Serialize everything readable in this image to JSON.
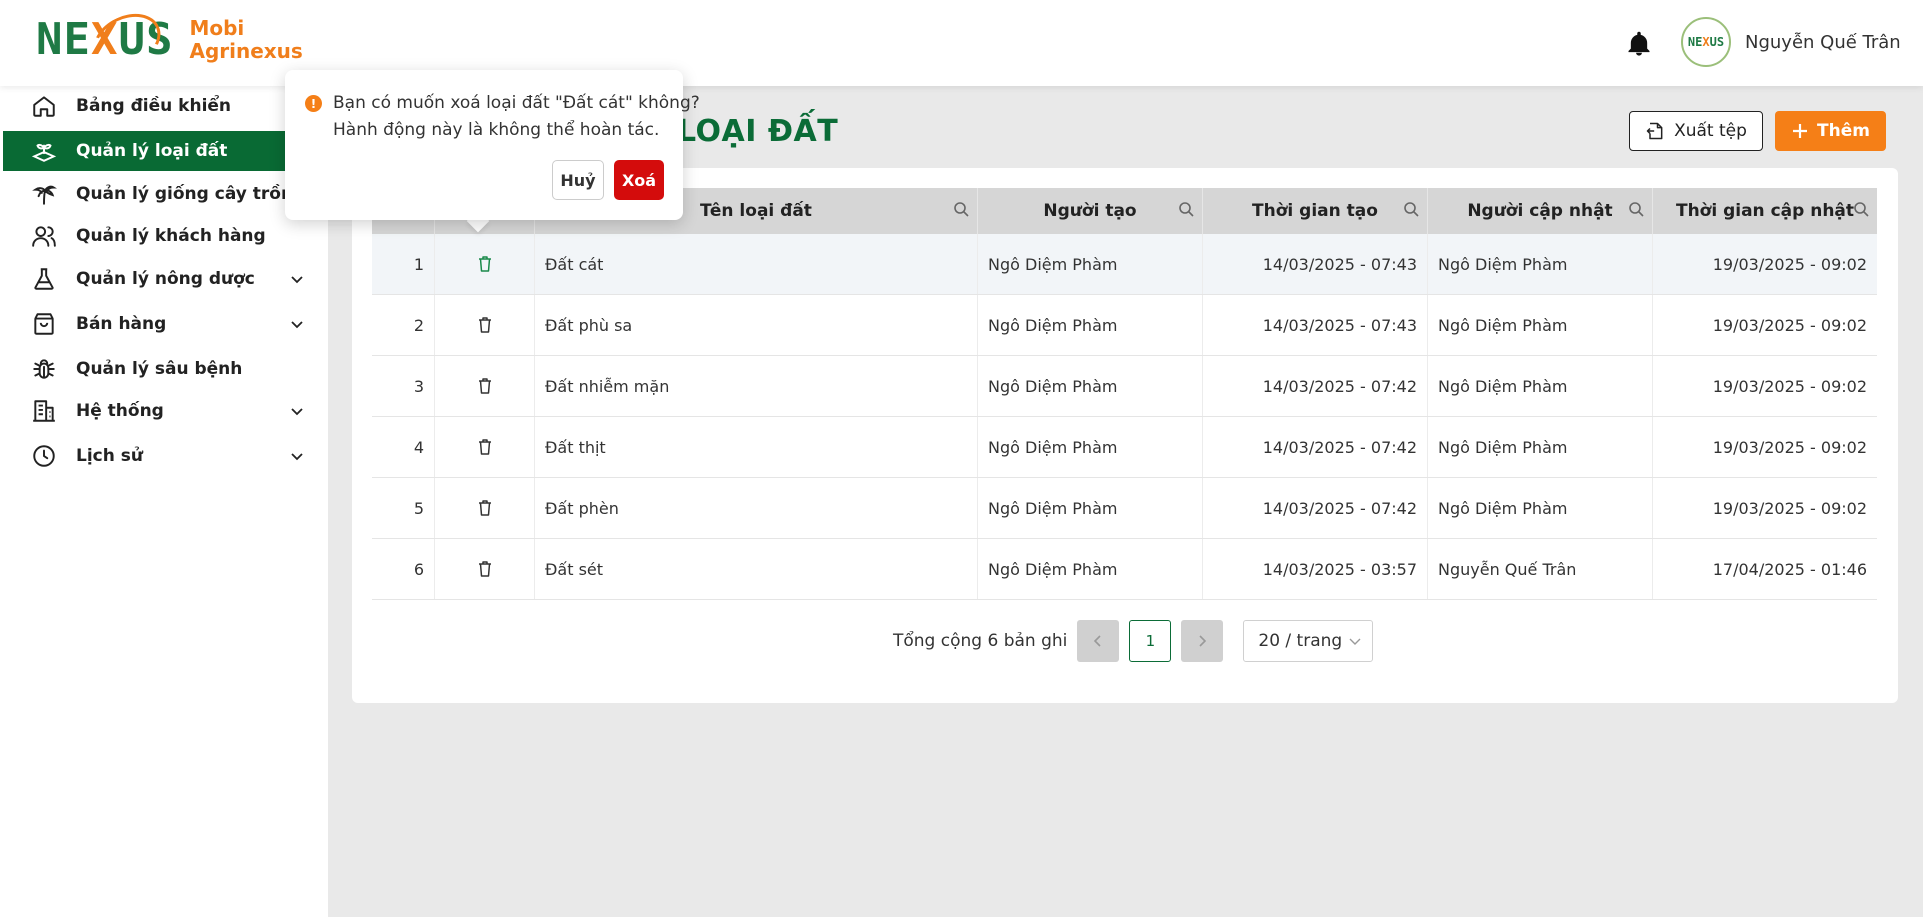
{
  "brand": {
    "line1": "Mobi",
    "line2": "Agrinexus",
    "logo_text": "NEXUS"
  },
  "header": {
    "user_name": "Nguyễn Quế Trân",
    "avatar_text": "NEXUS"
  },
  "sidebar": {
    "items": [
      {
        "label": "Bảng điều khiển",
        "icon": "home-icon",
        "active": false,
        "expandable": false
      },
      {
        "label": "Quản lý loại đất",
        "icon": "soil-sprout-icon",
        "active": true,
        "expandable": false
      },
      {
        "label": "Quản lý giống cây trồng",
        "icon": "palm-tree-icon",
        "active": false,
        "expandable": false
      },
      {
        "label": "Quản lý khách hàng",
        "icon": "users-icon",
        "active": false,
        "expandable": false
      },
      {
        "label": "Quản lý nông dược",
        "icon": "flask-icon",
        "active": false,
        "expandable": true
      },
      {
        "label": "Bán hàng",
        "icon": "shopping-bag-icon",
        "active": false,
        "expandable": true
      },
      {
        "label": "Quản lý sâu bệnh",
        "icon": "bug-icon",
        "active": false,
        "expandable": false
      },
      {
        "label": "Hệ thống",
        "icon": "building-icon",
        "active": false,
        "expandable": true
      },
      {
        "label": "Lịch sử",
        "icon": "clock-icon",
        "active": false,
        "expandable": true
      }
    ]
  },
  "main": {
    "title_visible": "LOẠI ĐẤT",
    "export_label": "Xuất tệp",
    "add_label": "Thêm"
  },
  "table": {
    "columns": [
      "Tên loại đất",
      "Người tạo",
      "Thời gian tạo",
      "Người cập nhật",
      "Thời gian cập nhật"
    ],
    "rows": [
      {
        "no": "1",
        "name": "Đất cát",
        "creator": "Ngô Diệm Phàm",
        "created": "14/03/2025 - 07:43",
        "updater": "Ngô Diệm Phàm",
        "updated": "19/03/2025 - 09:02"
      },
      {
        "no": "2",
        "name": "Đất phù sa",
        "creator": "Ngô Diệm Phàm",
        "created": "14/03/2025 - 07:43",
        "updater": "Ngô Diệm Phàm",
        "updated": "19/03/2025 - 09:02"
      },
      {
        "no": "3",
        "name": "Đất nhiễm mặn",
        "creator": "Ngô Diệm Phàm",
        "created": "14/03/2025 - 07:42",
        "updater": "Ngô Diệm Phàm",
        "updated": "19/03/2025 - 09:02"
      },
      {
        "no": "4",
        "name": "Đất thịt",
        "creator": "Ngô Diệm Phàm",
        "created": "14/03/2025 - 07:42",
        "updater": "Ngô Diệm Phàm",
        "updated": "19/03/2025 - 09:02"
      },
      {
        "no": "5",
        "name": "Đất phèn",
        "creator": "Ngô Diệm Phàm",
        "created": "14/03/2025 - 07:42",
        "updater": "Ngô Diệm Phàm",
        "updated": "19/03/2025 - 09:02"
      },
      {
        "no": "6",
        "name": "Đất sét",
        "creator": "Ngô Diệm Phàm",
        "created": "14/03/2025 - 03:57",
        "updater": "Nguyễn Quế Trân",
        "updated": "17/04/2025 - 01:46"
      }
    ]
  },
  "pagination": {
    "total_label": "Tổng cộng 6 bản ghi",
    "current_page": "1",
    "page_size": "20 / trang"
  },
  "popconfirm": {
    "line1": "Bạn có muốn xoá loại đất \"Đất cát\" không?",
    "line2": "Hành động này là không thể hoàn tác.",
    "icon_text": "!",
    "cancel_label": "Huỷ",
    "confirm_label": "Xoá"
  },
  "colors": {
    "primary": "#096a34",
    "accent": "#f57f17",
    "danger": "#d40c0c"
  }
}
